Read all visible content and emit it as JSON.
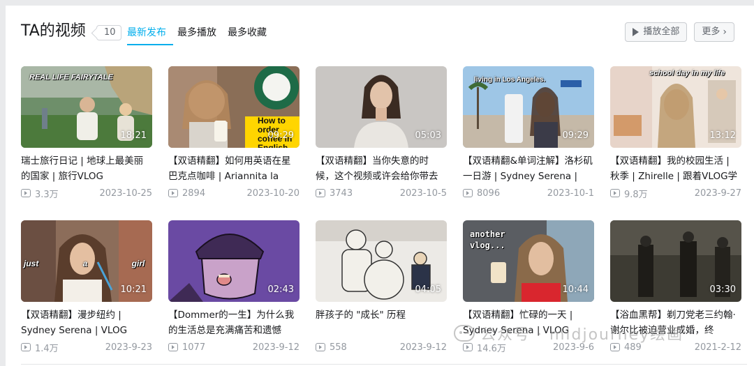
{
  "header": {
    "title": "TA的视频",
    "count": "10",
    "tabs": [
      {
        "label": "最新发布",
        "active": true
      },
      {
        "label": "最多播放",
        "active": false
      },
      {
        "label": "最多收藏",
        "active": false
      }
    ],
    "play_all_label": "播放全部",
    "more_label": "更多"
  },
  "videos": [
    {
      "title": "瑞士旅行日记 | 地球上最美丽的国家 | 旅行VLOG",
      "duration": "18:21",
      "plays": "3.3万",
      "date": "2023-10-25",
      "thumb_text": "REAL LIFE FAIRYTALE"
    },
    {
      "title": "【双语精翻】如何用英语在星巴克点咖啡 | Ariannita la",
      "duration": "09:29",
      "plays": "2894",
      "date": "2023-10-20",
      "thumb_text": "How to order coffee in English"
    },
    {
      "title": "【双语精翻】当你失意的时候，这个视频或许会给你带去",
      "duration": "05:03",
      "plays": "3743",
      "date": "2023-10-5",
      "thumb_text": ""
    },
    {
      "title": "【双语精翻&单词注解】洛杉矶一日游 | Sydney Serena |",
      "duration": "09:29",
      "plays": "8096",
      "date": "2023-10-1",
      "thumb_text": "living in Los Angeles."
    },
    {
      "title": "【双语精翻】我的校园生活 | 秋季 | Zhirelle | 跟着VLOG学",
      "duration": "13:12",
      "plays": "9.8万",
      "date": "2023-9-27",
      "thumb_text": "school day in my life"
    },
    {
      "title": "【双语精翻】漫步纽约 | Sydney Serena | VLOG",
      "duration": "10:21",
      "plays": "1.4万",
      "date": "2023-9-23",
      "thumb_text": "just a girl in new york"
    },
    {
      "title": "【Dommer的一生】为什么我的生活总是充满痛苦和遗憾",
      "duration": "02:43",
      "plays": "1077",
      "date": "2023-9-12",
      "thumb_text": ""
    },
    {
      "title": "胖孩子的 \"成长\" 历程",
      "duration": "04:05",
      "plays": "558",
      "date": "2023-9-12",
      "thumb_text": ""
    },
    {
      "title": "【双语精翻】忙碌的一天 | Sydney Serena | VLOG",
      "duration": "10:44",
      "plays": "14.6万",
      "date": "2023-9-6",
      "thumb_text": "another vlog..."
    },
    {
      "title": "【浴血黑帮】剃刀党老三约翰·谢尔比被迫营业成婚，终",
      "duration": "03:30",
      "plays": "489",
      "date": "2021-2-12",
      "thumb_text": ""
    }
  ],
  "watermark": "公众号 · midjourney绘画",
  "colors": {
    "accent": "#00aeec",
    "text": "#18191c",
    "muted": "#9499a0"
  }
}
